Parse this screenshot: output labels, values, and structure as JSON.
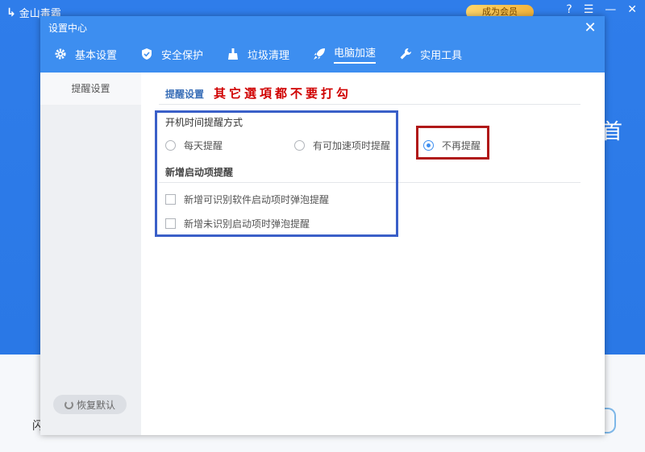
{
  "background_app": {
    "name": "金山毒霸",
    "vip_label": "成为会员",
    "wide_char": "首",
    "bottom_char": "闪"
  },
  "dialog": {
    "title": "设置中心",
    "tabs": [
      {
        "label": "基本设置",
        "icon": "gear-icon"
      },
      {
        "label": "安全保护",
        "icon": "shield-icon"
      },
      {
        "label": "垃圾清理",
        "icon": "broom-icon"
      },
      {
        "label": "电脑加速",
        "icon": "rocket-icon",
        "active": true
      },
      {
        "label": "实用工具",
        "icon": "wrench-icon"
      }
    ],
    "sidebar": {
      "items": [
        {
          "label": "提醒设置"
        }
      ],
      "restore_label": "恢复默认"
    },
    "content": {
      "section_title": "提醒设置",
      "annotation": "其它選項都不要打勾",
      "boot_reminder": {
        "title": "开机时间提醒方式",
        "options": [
          {
            "label": "每天提醒",
            "checked": false
          },
          {
            "label": "有可加速项时提醒",
            "checked": false
          },
          {
            "label": "不再提醒",
            "checked": true
          }
        ]
      },
      "startup_items": {
        "title": "新增启动项提醒",
        "options": [
          {
            "label": "新增可识别软件启动项时弹泡提醒",
            "checked": false
          },
          {
            "label": "新增未识别启动项时弹泡提醒",
            "checked": false
          }
        ]
      }
    }
  },
  "colors": {
    "header_blue": "#3d8ef0",
    "annotation_red": "#d00000",
    "highlight_blue": "#3a5fc8",
    "highlight_red": "#b01818"
  }
}
